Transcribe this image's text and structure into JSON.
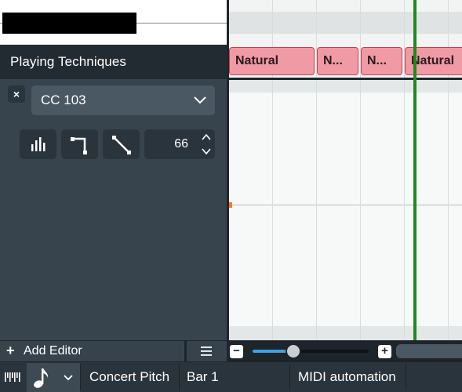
{
  "playing_techniques": {
    "header_label": "Playing Techniques",
    "blocks": [
      "Natural",
      "N...",
      "N...",
      "Natural"
    ]
  },
  "automation_editor": {
    "controller_select": "CC 103",
    "value": "66",
    "close_symbol": "×"
  },
  "toolbar": {
    "add_editor_label": "Add Editor",
    "add_editor_symbol": "+",
    "zoom_out_symbol": "−",
    "zoom_in_symbol": "+",
    "zoom_level_fraction": 0.35
  },
  "status_bar": {
    "concert_pitch": "Concert Pitch",
    "bar_position": "Bar 1",
    "mode": "MIDI automation"
  },
  "colors": {
    "playhead": "#1e8a1e",
    "technique_block_fill": "#f09aa5",
    "technique_block_border": "#c4404f",
    "zoom_accent": "#3da0e8",
    "marker": "#f07a20"
  },
  "icons": {
    "close": "close-icon",
    "dropdown": "chevron-down-icon",
    "bars_tool": "bar-graph-icon",
    "step_tool": "step-line-icon",
    "linear_tool": "linear-line-icon",
    "spin_up": "chevron-up-icon",
    "spin_down": "chevron-down-icon",
    "menu": "hamburger-menu-icon",
    "piano": "piano-keys-icon",
    "note": "eighth-note-icon",
    "note_dropdown": "chevron-down-icon"
  }
}
